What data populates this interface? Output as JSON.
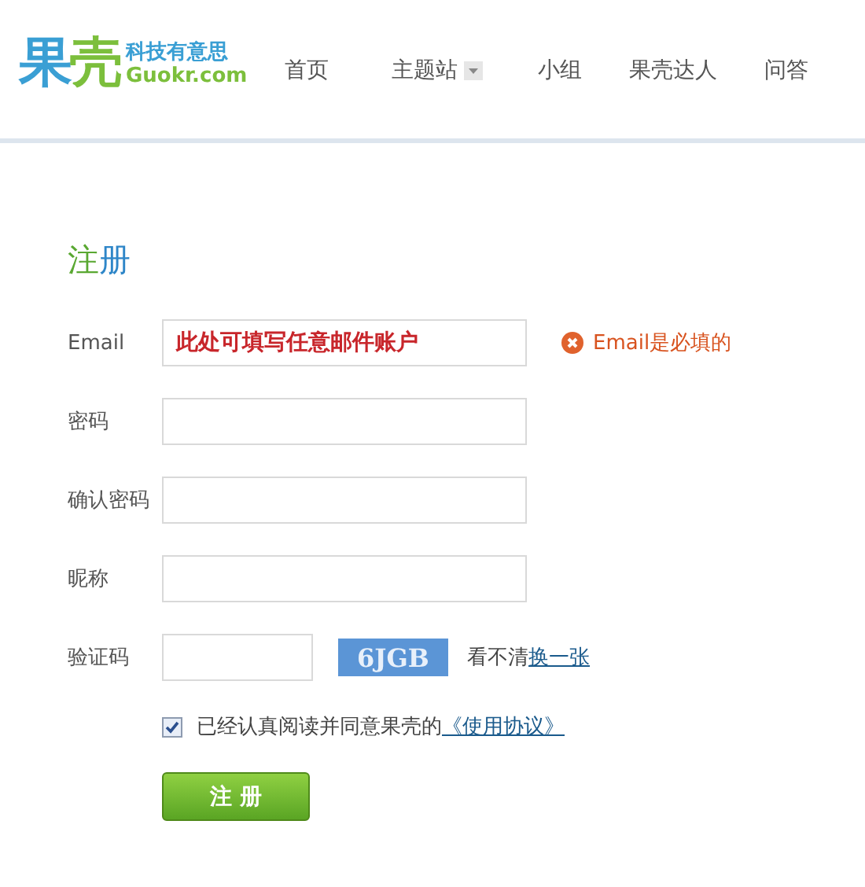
{
  "logo": {
    "parts": [
      {
        "text": "果",
        "color": "#3a9fd4"
      },
      {
        "text": "壳",
        "color": "#7cbf3c"
      }
    ],
    "tagline": "科技有意思",
    "domain": "Guokr.com"
  },
  "nav": [
    {
      "label": "首页",
      "has_dropdown": false
    },
    {
      "label": "主题站",
      "has_dropdown": true
    },
    {
      "label": "小组",
      "has_dropdown": false
    },
    {
      "label": "果壳达人",
      "has_dropdown": false
    },
    {
      "label": "问答",
      "has_dropdown": false
    }
  ],
  "title": {
    "parts": [
      {
        "text": "注",
        "color": "#5aa832"
      },
      {
        "text": "册",
        "color": "#2e86c8"
      }
    ]
  },
  "fields": [
    {
      "label": "Email",
      "value": "此处可填写任意邮件账户",
      "error": "Email是必填的"
    },
    {
      "label": "密码"
    },
    {
      "label": "确认密码"
    },
    {
      "label": "昵称"
    }
  ],
  "captcha": {
    "label": "验证码",
    "image_text": "6JGB",
    "hint": "看不清",
    "refresh_link": "换一张"
  },
  "agreement": {
    "checked": true,
    "text": "已经认真阅读并同意果壳的",
    "link": "《使用协议》"
  },
  "submit": "注 册"
}
